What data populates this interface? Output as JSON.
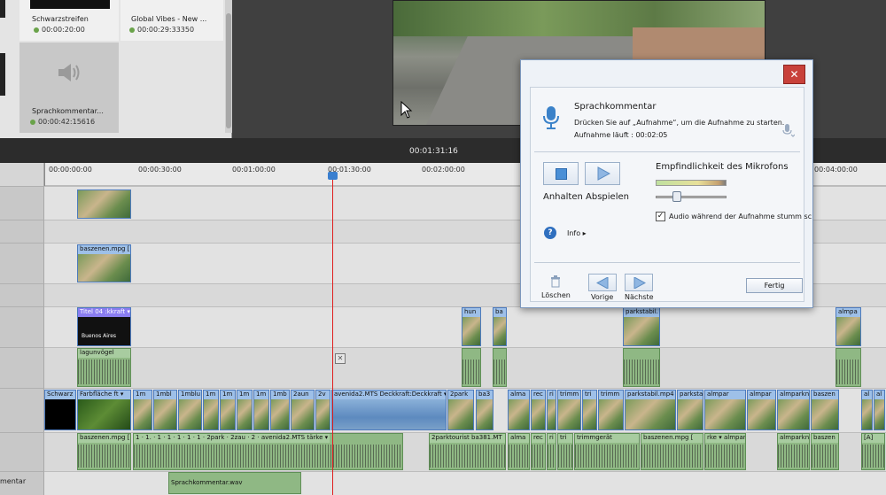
{
  "bin": {
    "tiles": [
      {
        "name": "Schwarzstreifen",
        "duration": "00:00:20:00"
      },
      {
        "name": "Global Vibes - New ...",
        "duration": "00:00:29:33350"
      },
      {
        "name": "Sprachkommentar...",
        "duration": "00:00:42:15616"
      }
    ]
  },
  "timeline": {
    "current_time": "00:01:31:16",
    "ruler_ticks": [
      "00:00:00:00",
      "00:00:30:00",
      "00:01:00:00",
      "00:01:30:00",
      "00:02:00:00",
      "00:04:00:00"
    ],
    "narration_track_label": "mentar",
    "clips": {
      "v3_top": "",
      "v2_baszenen": "baszenen.mpg [",
      "title_clip": "Titel 04",
      "title_fx": ":kkraft",
      "v1_hun": "hun",
      "v1_ba": "ba",
      "v1_parkstabil": "parkstabil.",
      "v1_almpa": "almpa",
      "title_sub": "Buenos Aires",
      "a1_lagun": "lagunvögel",
      "main_schwarz": "Schwarz",
      "main_farb": "Farbfläche",
      "main_farb_fx": "ft",
      "main_1m_a": "1m",
      "main_1mbl": "1mbl",
      "main_1mblu": "1mblu",
      "main_1m_b": "1m",
      "main_1m_c": "1m",
      "main_1m_d": "1m",
      "main_1mb": "1mb",
      "main_2aun": "2aun",
      "main_2v": "2v",
      "main_avenida": "avenida2.MTS",
      "main_avenida_fx": "Deckkraft:Deckkraft",
      "main_2park": "2park",
      "main_ba3": "ba3",
      "main_alma": "alma",
      "main_rec": "rec",
      "main_ri": "ri",
      "main_trimm1": "trimm",
      "main_tri": "tri",
      "main_trimm2": "trimm",
      "main_parkstabil": "parkstabil.mp4",
      "main_parksta": "parksta",
      "main_almpar1": "almpar",
      "main_almpar2": "almpar",
      "main_almparkn1": "almparkn",
      "main_almparkn2": "almparkn",
      "main_baszen": "baszen",
      "main_al": "al",
      "main_al2": "al",
      "a_baszenen": "baszenen.mpg [",
      "a_1a": "1",
      "a_1b": "1.",
      "a_1c": "1",
      "a_1d": "1",
      "a_1e": "1",
      "a_1f": "1",
      "a_1g": "1",
      "a_2parkt": "2park",
      "a_2zau": "2zau",
      "a_2v": "2",
      "a_avenida": "avenida2.MTS",
      "a_avenida_fx": "tärke",
      "a_2parktourist": "2parktourist",
      "a_ba381": "ba381.MT",
      "a_alma": "alma",
      "a_rec": "rec",
      "a_ri": "ri",
      "a_trimmgeraet": "trimmgerät",
      "a_baszenen2": "baszenen.mpg [",
      "a_fx2": "rke",
      "a_almpar": "almpar",
      "a_almparkn": "almparkn",
      "a_baszen": "baszen",
      "a_al": "[A]",
      "narration_clip": "Sprachkommentar.wav"
    }
  },
  "dialog": {
    "title": "Sprachkommentar",
    "description": "Drücken Sie auf „Aufnahme“, um die Aufnahme zu starten.",
    "status": "Aufnahme läuft : 00:02:05",
    "close_label": "✕",
    "stop_play_label": "Anhalten Abspielen",
    "sensitivity_label": "Empfindlichkeit des Mikrofons",
    "mic_level": 0.35,
    "mute_checked": true,
    "mute_label": "Audio während der Aufnahme stumm sc",
    "info_label": "Info ▸",
    "delete_label": "Löschen",
    "prev_label": "Vorige",
    "next_label": "Nächste",
    "done_label": "Fertig"
  }
}
